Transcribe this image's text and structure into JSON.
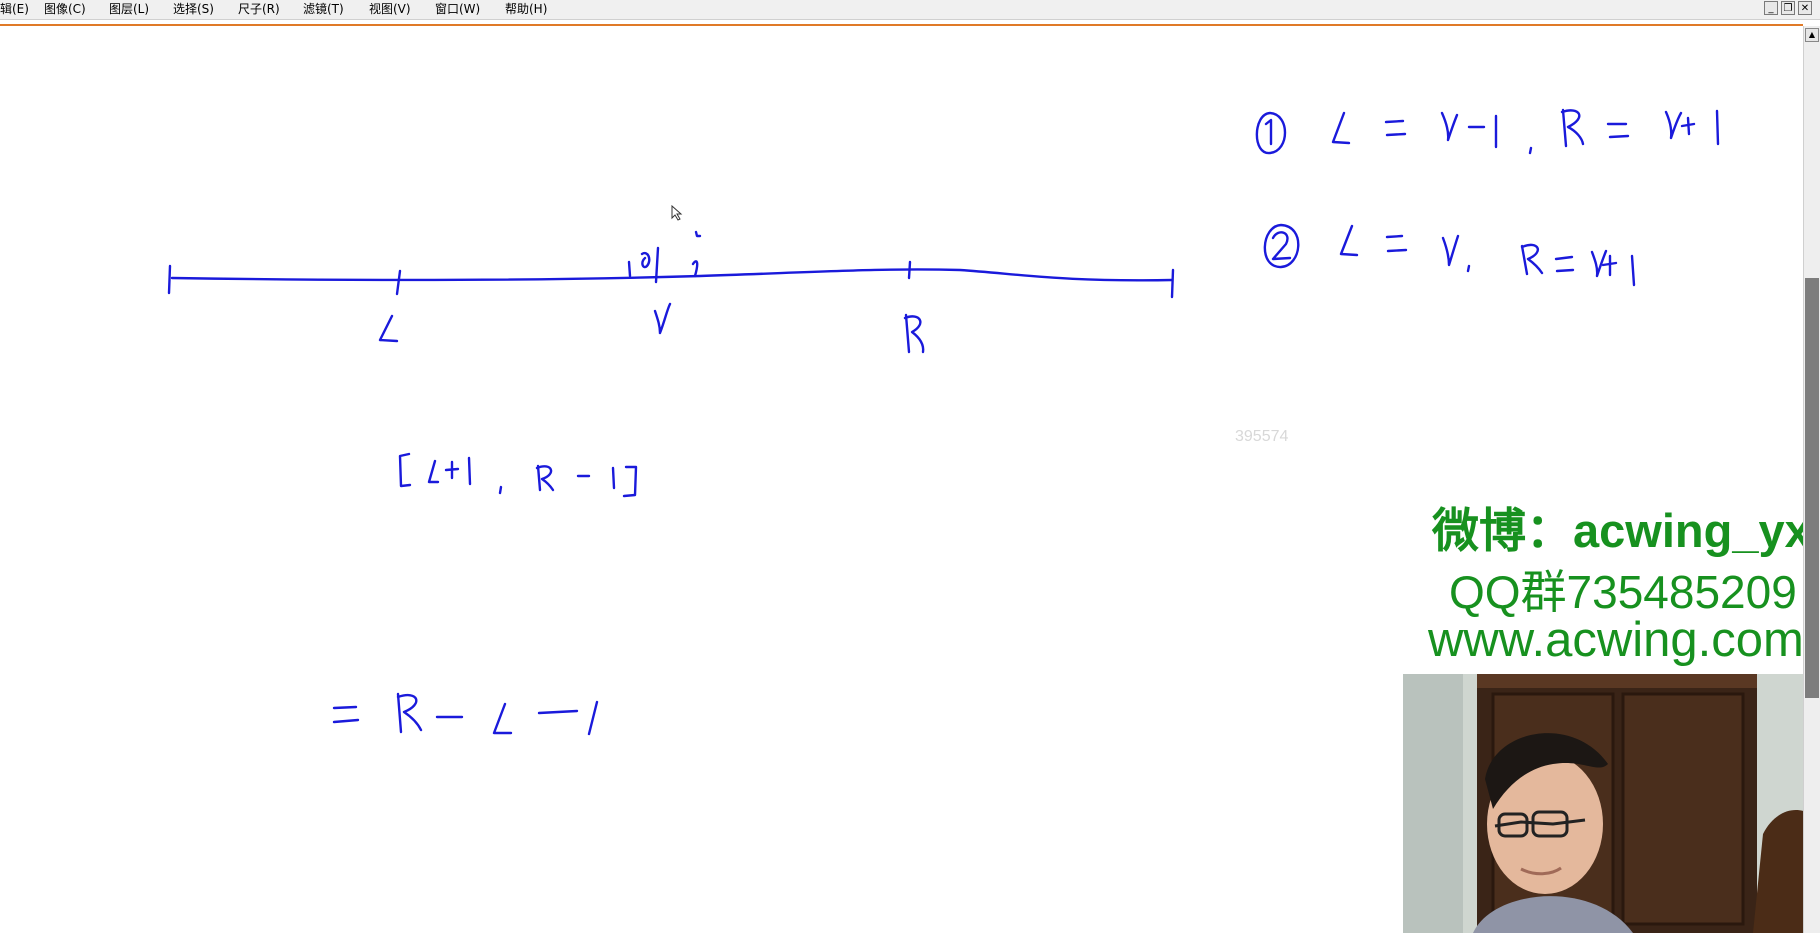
{
  "menubar": {
    "items": [
      "辑(E)",
      "图像(C)",
      "图层(L)",
      "选择(S)",
      "尺子(R)",
      "滤镜(T)",
      "视图(V)",
      "窗口(W)",
      "帮助(H)"
    ],
    "controls": [
      "minimize",
      "restore",
      "close"
    ]
  },
  "whiteboard": {
    "background": "#ffffff",
    "ink_color": "#1a1adb",
    "number_line_labels": [
      "L",
      "i",
      "R"
    ],
    "case_1": "① L = i-1, R = i+1",
    "case_2": "② L = i, R = i+1",
    "interval": "[L+1, R-1]",
    "length": "= R - L - 1",
    "watermark_number": "395574"
  },
  "overlay": {
    "weibo": "微博：acwing_yxc",
    "qq": "QQ群735485209",
    "site": "www.acwing.com",
    "color": "#17911f"
  },
  "icons": [
    "cursor-icon",
    "scroll-up-icon"
  ]
}
